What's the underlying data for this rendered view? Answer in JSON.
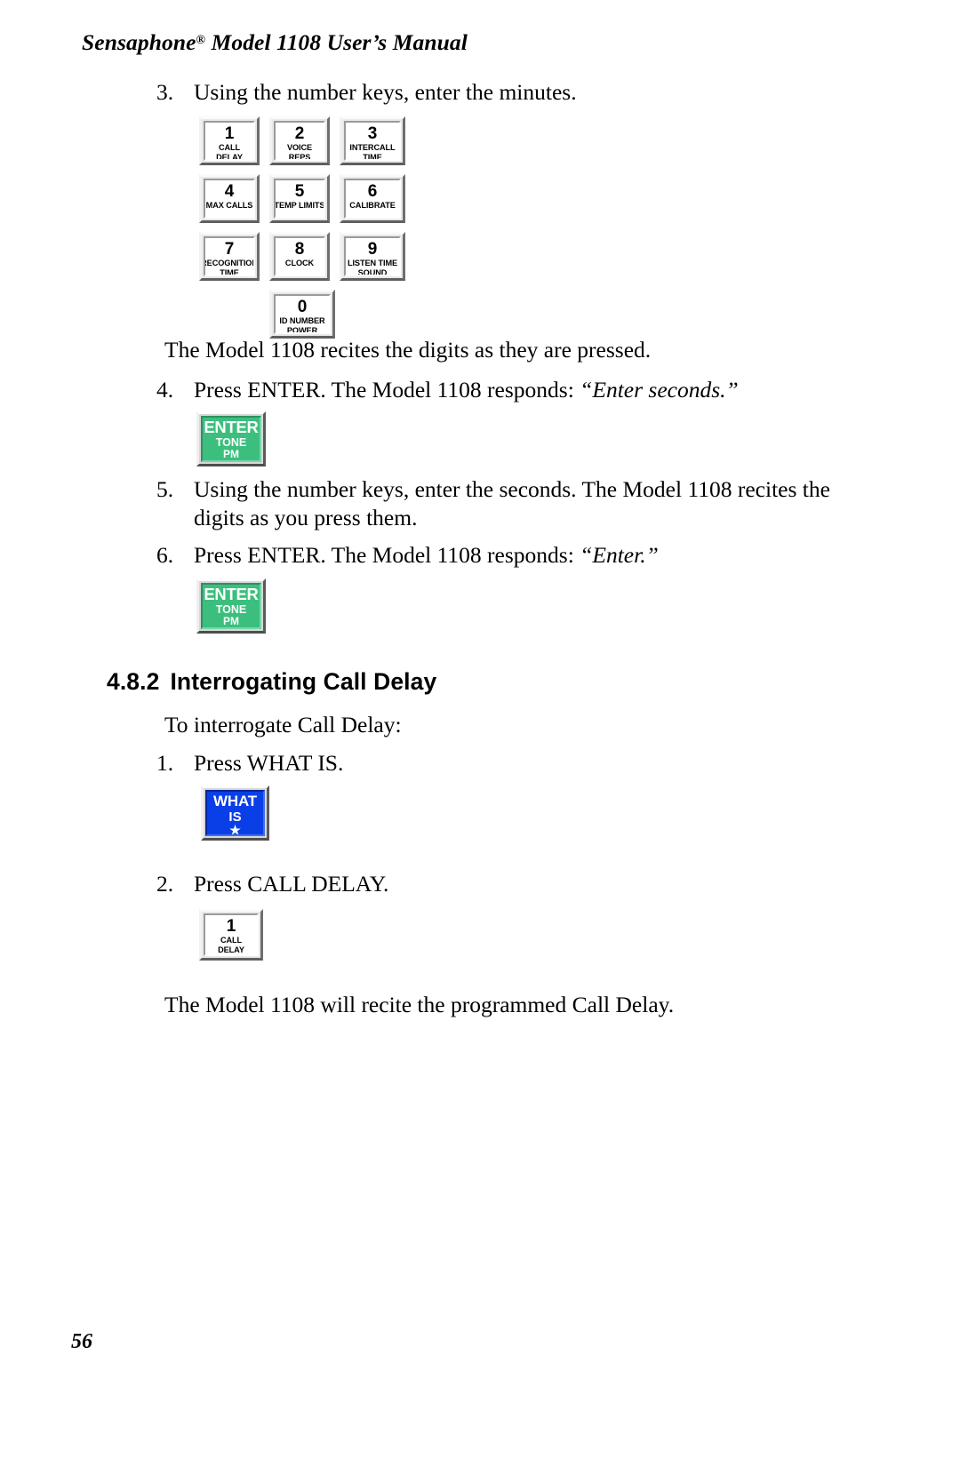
{
  "header": {
    "title_pre": "Sensaphone",
    "registered_mark": "®",
    "title_post": " Model 1108 User’s Manual"
  },
  "steps": {
    "step3": {
      "num": "3.",
      "text": "Using the number keys, enter the minutes."
    },
    "step4": {
      "num": "4.",
      "text_plain": "Press ENTER. The Model 1108 responds: ",
      "text_italic": "“Enter seconds.”"
    },
    "step5": {
      "num": "5.",
      "text": "Using the number keys, enter the seconds. The Model 1108 recites the digits as you press them."
    },
    "step6": {
      "num": "6.",
      "text_plain": "Press ENTER. The Model 1108 responds: ",
      "text_italic": "“Enter.”"
    },
    "step_i1": {
      "num": "1.",
      "text": "Press WHAT IS."
    },
    "step_i2": {
      "num": "2.",
      "text": "Press CALL DELAY."
    }
  },
  "paragraphs": {
    "recites_digits": "The Model 1108 recites the digits as they are pressed.",
    "to_interrogate": "To interrogate Call Delay:",
    "will_recite": "The Model 1108 will recite the programmed Call Delay."
  },
  "section": {
    "number": "4.8.2",
    "title": "Interrogating Call Delay"
  },
  "keypad": {
    "rows": [
      [
        {
          "digit": "1",
          "lines": [
            "CALL",
            "DELAY"
          ]
        },
        {
          "digit": "2",
          "lines": [
            "VOICE",
            "REPS"
          ]
        },
        {
          "digit": "3",
          "lines": [
            "INTERCALL",
            "TIME"
          ]
        }
      ],
      [
        {
          "digit": "4",
          "lines": [
            "MAX CALLS"
          ]
        },
        {
          "digit": "5",
          "lines": [
            "TEMP LIMITS"
          ]
        },
        {
          "digit": "6",
          "lines": [
            "CALIBRATE"
          ]
        }
      ],
      [
        {
          "digit": "7",
          "lines": [
            "RECOGNITION",
            "TIME"
          ]
        },
        {
          "digit": "8",
          "lines": [
            "CLOCK"
          ]
        },
        {
          "digit": "9",
          "lines": [
            "LISTEN TIME",
            "SOUND"
          ]
        }
      ],
      [
        {
          "digit": "0",
          "lines": [
            "ID NUMBER",
            "POWER"
          ]
        }
      ]
    ]
  },
  "buttons": {
    "enter": {
      "top": "ENTER",
      "mid": "TONE",
      "bottom": "PM",
      "color": "#3cbf7e"
    },
    "what_is": {
      "top": "WHAT",
      "mid": "IS",
      "star": "★",
      "color": "#0a3fe8"
    },
    "call_delay": {
      "digit": "1",
      "line1": "CALL",
      "line2": "DELAY"
    }
  },
  "folio": {
    "page_number": "56"
  }
}
